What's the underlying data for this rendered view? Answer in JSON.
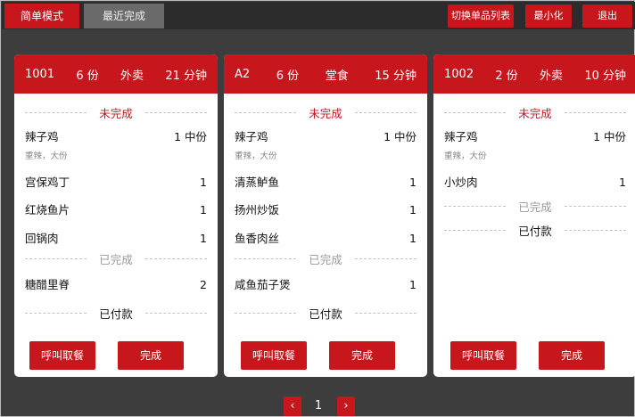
{
  "topbar": {
    "tabs": [
      "简单模式",
      "最近完成"
    ],
    "buttons": [
      "切换单品列表",
      "最小化",
      "退出"
    ]
  },
  "orders": [
    {
      "id": "1001",
      "portions": "6 份",
      "type": "外卖",
      "time": "21 分钟",
      "pending_label": "未完成",
      "pending": [
        {
          "name": "辣子鸡",
          "qty": "1 中份",
          "note": "重辣，大份"
        },
        {
          "name": "宫保鸡丁",
          "qty": "1"
        },
        {
          "name": "红烧鱼片",
          "qty": "1"
        },
        {
          "name": "回锅肉",
          "qty": "1"
        }
      ],
      "done_label": "已完成",
      "done": [
        {
          "name": "糖醋里脊",
          "qty": "2"
        }
      ],
      "paid_label": "已付款",
      "call_button": "呼叫取餐",
      "finish_button": "完成"
    },
    {
      "id": "A2",
      "portions": "6 份",
      "type": "堂食",
      "time": "15 分钟",
      "pending_label": "未完成",
      "pending": [
        {
          "name": "辣子鸡",
          "qty": "1 中份",
          "note": "重辣，大份"
        },
        {
          "name": "清蒸鲈鱼",
          "qty": "1"
        },
        {
          "name": "扬州炒饭",
          "qty": "1"
        },
        {
          "name": "鱼香肉丝",
          "qty": "1"
        }
      ],
      "done_label": "已完成",
      "done": [
        {
          "name": "咸鱼茄子煲",
          "qty": "1"
        }
      ],
      "paid_label": "已付款",
      "call_button": "呼叫取餐",
      "finish_button": "完成"
    },
    {
      "id": "1002",
      "portions": "2 份",
      "type": "外卖",
      "time": "10 分钟",
      "pending_label": "未完成",
      "pending": [
        {
          "name": "辣子鸡",
          "qty": "1 中份",
          "note": "重辣，大份"
        },
        {
          "name": "小炒肉",
          "qty": "1"
        }
      ],
      "done_label": "已完成",
      "done": [],
      "paid_label": "已付款",
      "call_button": "呼叫取餐",
      "finish_button": "完成"
    }
  ],
  "pagination": {
    "prev": "‹",
    "page": "1",
    "next": "›"
  },
  "colors": {
    "accent": "#c8161d",
    "background": "#3d3d3d",
    "topbar": "#2c2c2c",
    "inactive_tab": "#6a6a6a"
  }
}
